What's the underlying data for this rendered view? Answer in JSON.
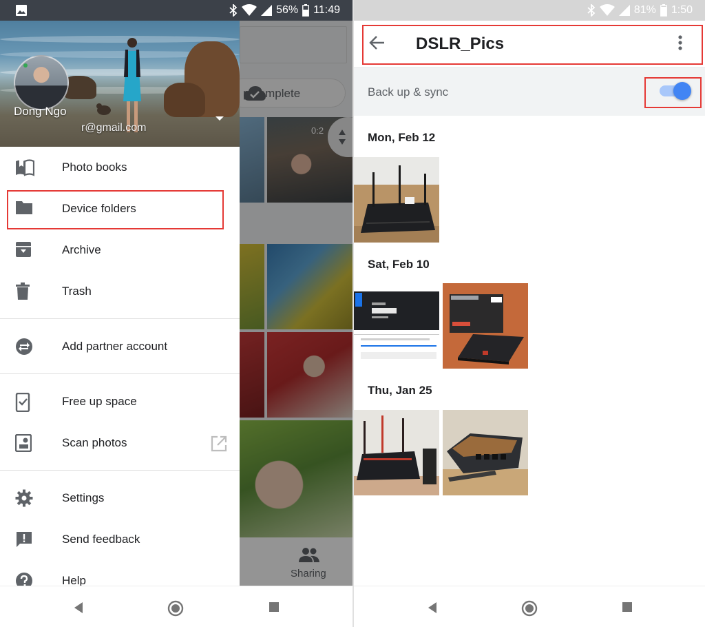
{
  "left_screen": {
    "status_bar": {
      "battery_percent": "56%",
      "time": "11:49",
      "icons": [
        "image-icon",
        "bluetooth-icon",
        "wifi-icon",
        "cell-signal-icon",
        "battery-icon"
      ]
    },
    "drawer": {
      "account": {
        "name": "Dong Ngo",
        "email": "r@gmail.com"
      },
      "items": [
        {
          "label": "Photo books",
          "icon": "book-icon"
        },
        {
          "label": "Device folders",
          "icon": "folder-icon",
          "highlighted": true
        },
        {
          "label": "Archive",
          "icon": "archive-icon"
        },
        {
          "label": "Trash",
          "icon": "trash-icon"
        },
        {
          "label": "Add partner account",
          "icon": "partner-swap-icon"
        },
        {
          "label": "Free up space",
          "icon": "phone-check-icon"
        },
        {
          "label": "Scan photos",
          "icon": "scan-photos-icon",
          "trailing_icon": "open-external-icon"
        },
        {
          "label": "Settings",
          "icon": "settings-gear-icon"
        },
        {
          "label": "Send feedback",
          "icon": "feedback-icon"
        },
        {
          "label": "Help",
          "icon": "help-icon"
        }
      ]
    },
    "background_view": {
      "backup_status": "p complete",
      "video_duration": "0:2",
      "bottom_nav_label": "Sharing"
    }
  },
  "right_screen": {
    "status_bar": {
      "battery_percent": "81%",
      "time": "1:50",
      "icons": [
        "bluetooth-icon",
        "wifi-icon",
        "cell-signal-icon",
        "battery-icon"
      ]
    },
    "app_bar": {
      "title": "DSLR_Pics"
    },
    "sync": {
      "label": "Back up & sync",
      "enabled": true
    },
    "groups": [
      {
        "date": "Mon, Feb 12",
        "photo_count": 1
      },
      {
        "date": "Sat, Feb 10",
        "photo_count": 2
      },
      {
        "date": "Thu, Jan 25",
        "photo_count": 2
      }
    ]
  },
  "colors": {
    "accent": "#4285f4",
    "highlight_box": "#e53935",
    "status_bar_left": "#3c4149",
    "status_bar_right": "#d6d6d6",
    "sync_row_bg": "#f1f3f4"
  }
}
